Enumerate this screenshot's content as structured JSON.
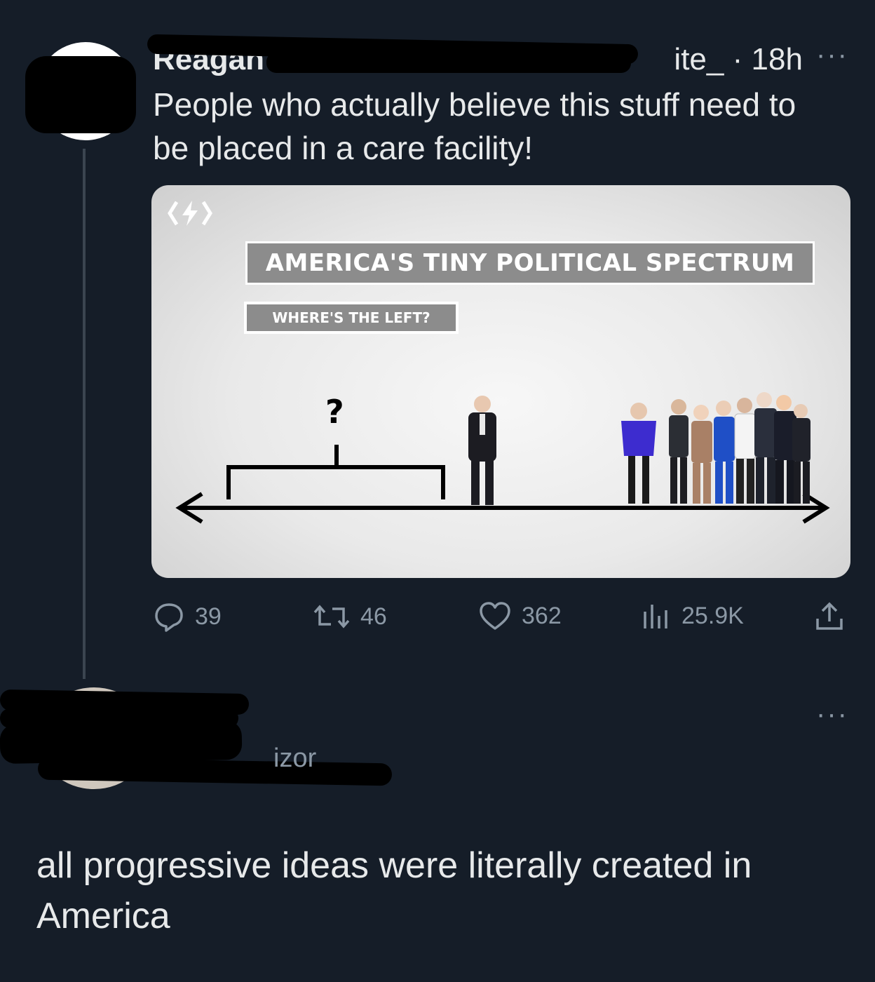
{
  "tweet": {
    "name_visible": "Reagan",
    "handle_fragment": "ite_",
    "separator": "·",
    "time": "18h",
    "more": "···",
    "text": "People who actually believe this stuff need to be placed in a care facility!",
    "media": {
      "title": "AMERICA'S TINY POLITICAL SPECTRUM",
      "subtitle": "WHERE'S THE LEFT?",
      "question": "?"
    },
    "actions": {
      "replies": "39",
      "retweets": "46",
      "likes": "362",
      "views": "25.9K"
    }
  },
  "reply": {
    "more": "···",
    "fragment": "izor",
    "text": "all progressive ideas were literally created in America"
  }
}
